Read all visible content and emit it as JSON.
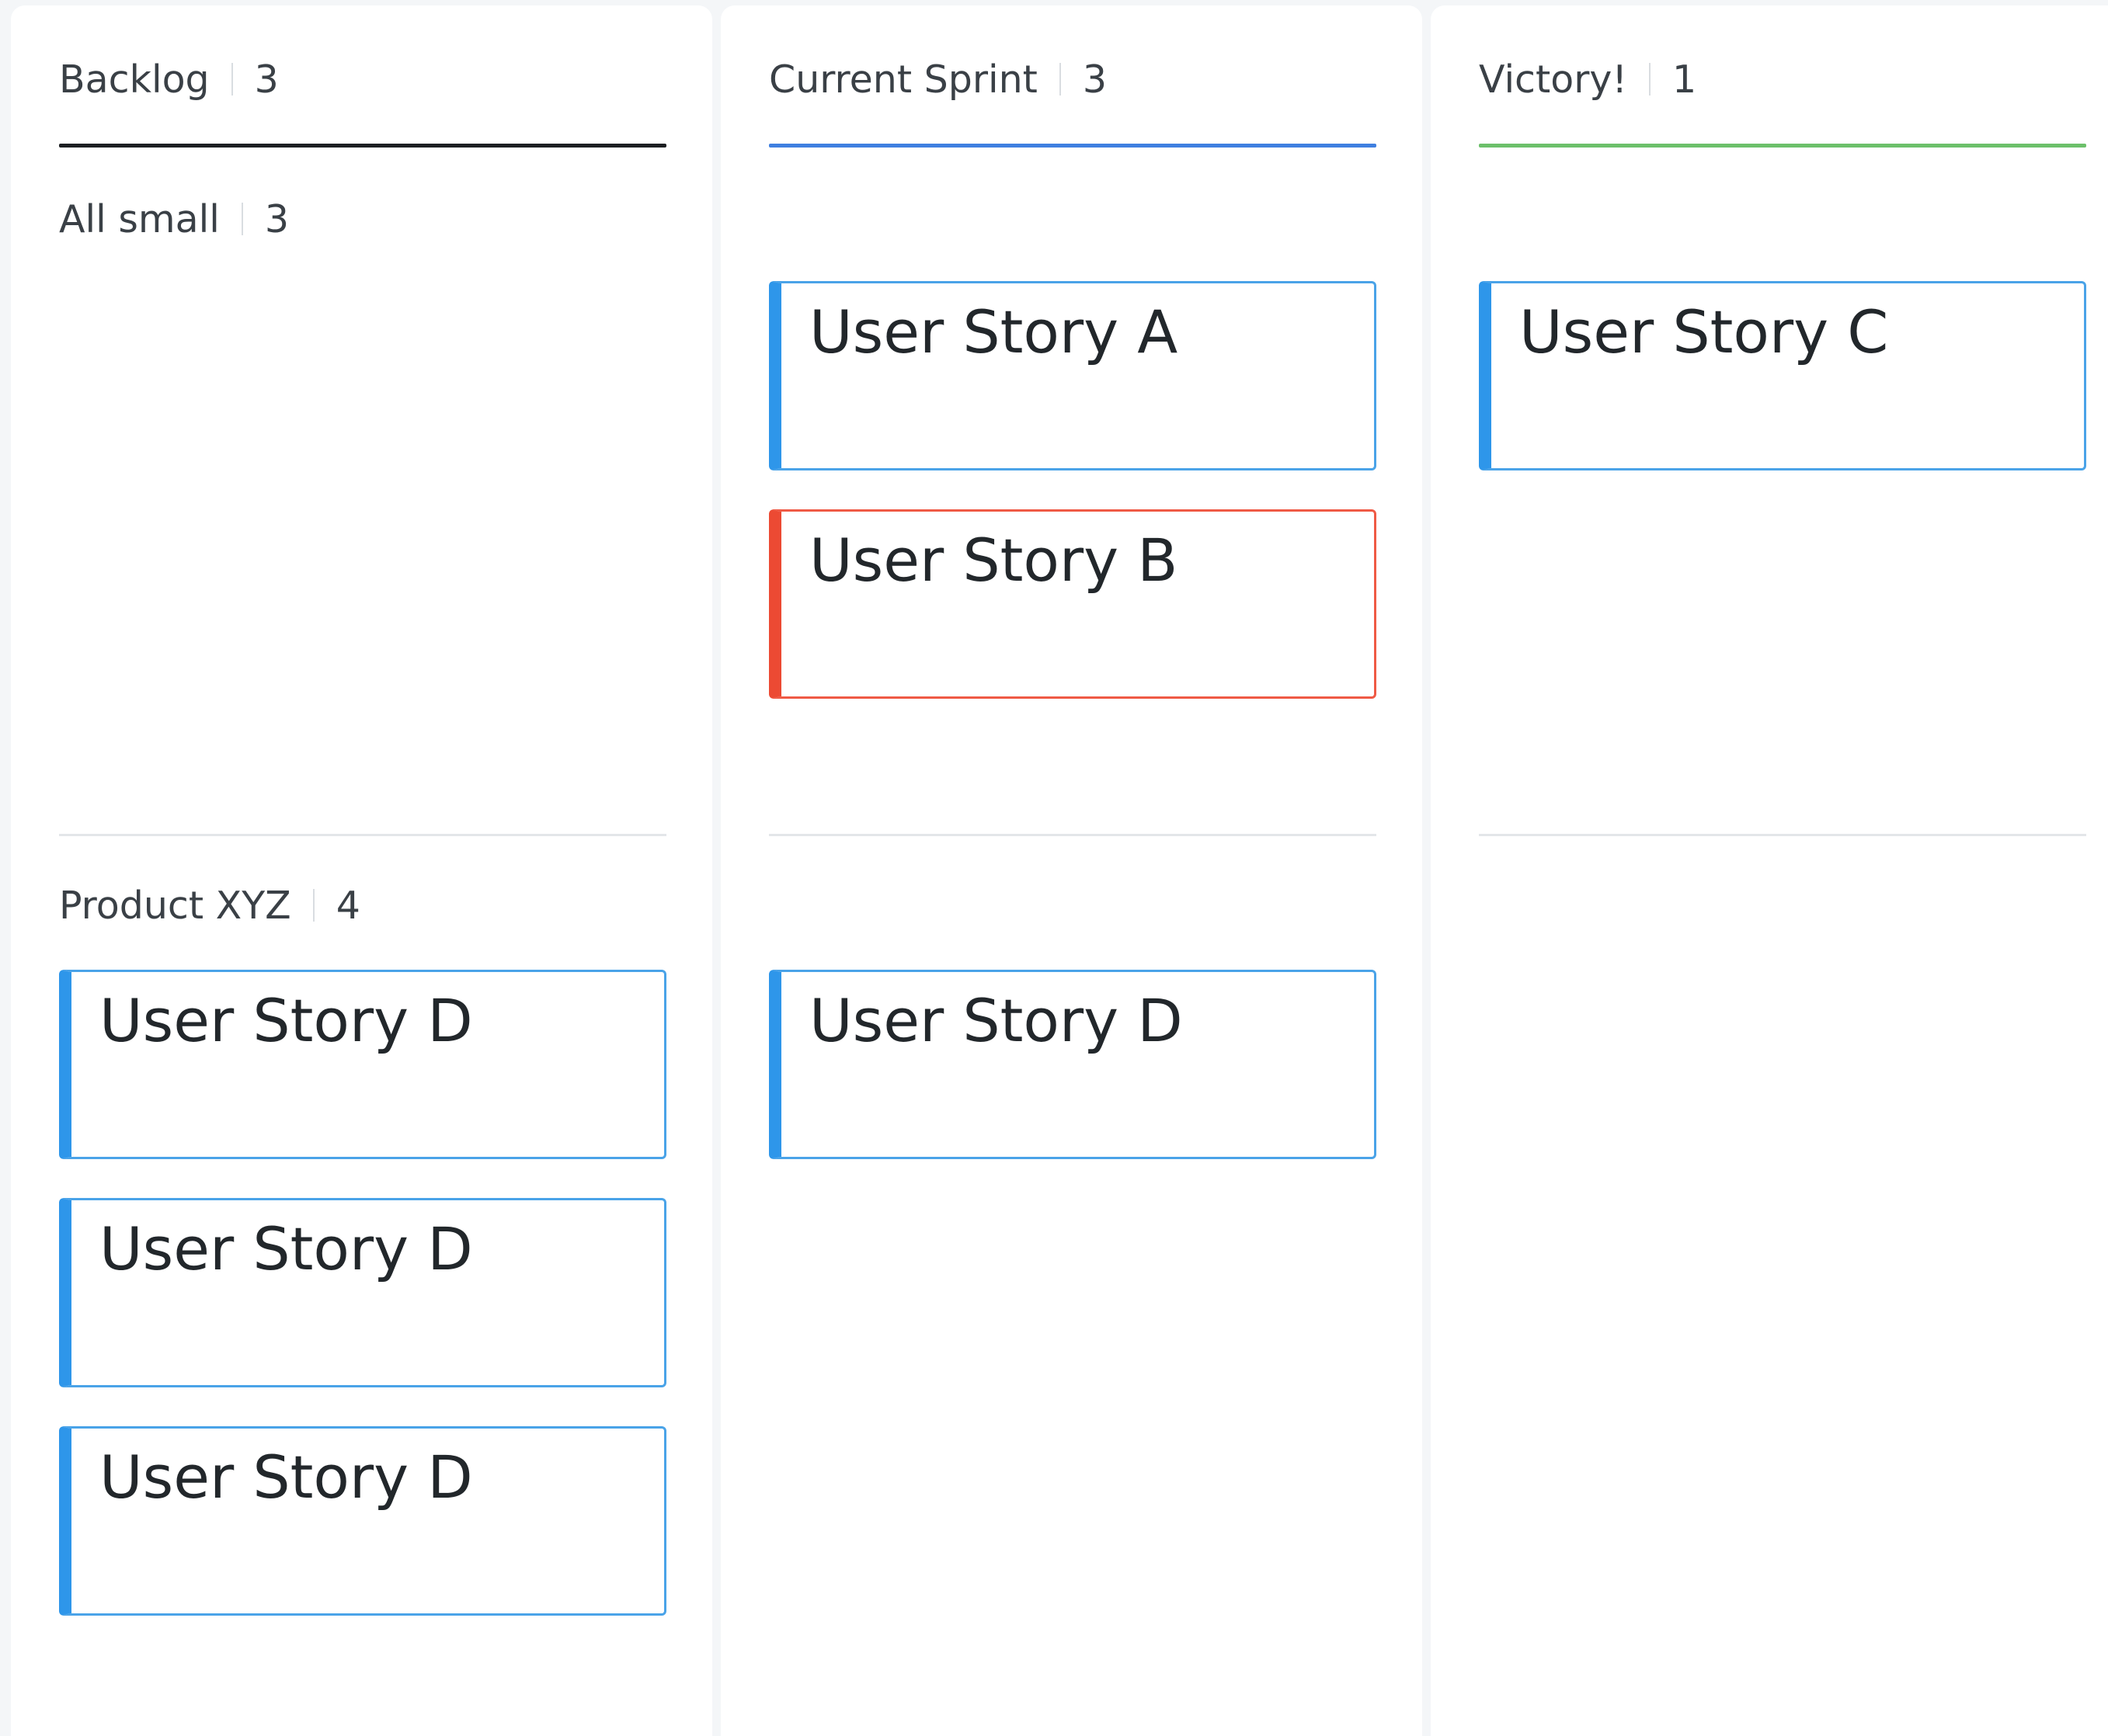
{
  "columns": [
    {
      "title": "Backlog",
      "count": "3",
      "accent": "#1c1f22",
      "lanes": [
        {
          "title": "All small",
          "count": "3",
          "cards": []
        },
        {
          "title": "Product XYZ",
          "count": "4",
          "cards": [
            {
              "title": "User Story D",
              "color": "#2e96ea"
            },
            {
              "title": "User Story D",
              "color": "#2e96ea"
            },
            {
              "title": "User Story D",
              "color": "#2e96ea"
            }
          ]
        }
      ]
    },
    {
      "title": "Current Sprint",
      "count": "3",
      "accent": "#3f7fe0",
      "lanes": [
        {
          "cards": [
            {
              "title": "User Story A",
              "color": "#2e96ea"
            },
            {
              "title": "User Story B",
              "color": "#ec4a33"
            }
          ]
        },
        {
          "cards": [
            {
              "title": "User Story D",
              "color": "#2e96ea"
            }
          ]
        }
      ]
    },
    {
      "title": "Victory!",
      "count": "1",
      "accent": "#6cc06a",
      "lanes": [
        {
          "cards": [
            {
              "title": "User Story C",
              "color": "#2e96ea"
            }
          ]
        },
        {
          "cards": []
        }
      ]
    }
  ]
}
